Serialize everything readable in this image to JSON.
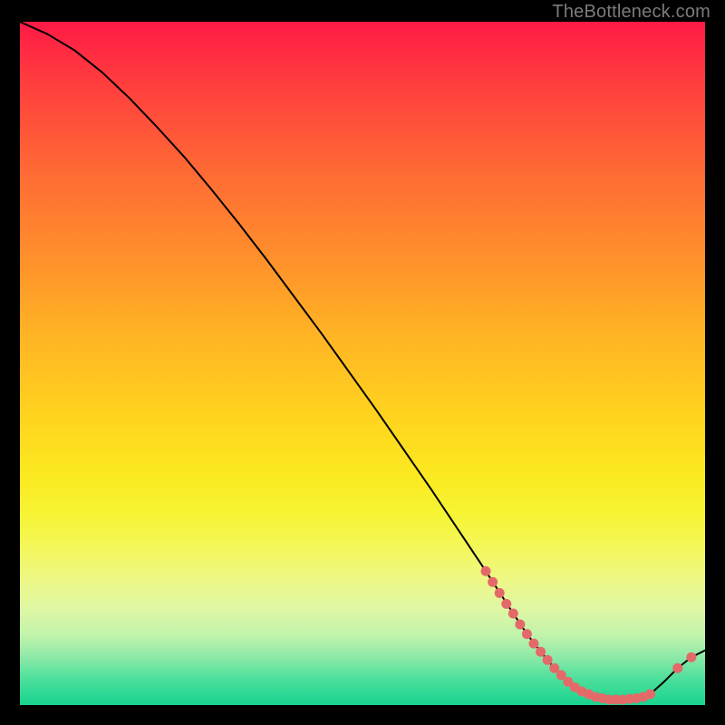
{
  "watermark": "TheBottleneck.com",
  "colors": {
    "curve_stroke": "#000000",
    "marker_fill": "#e46a6a",
    "marker_stroke": "#e46a6a",
    "frame_bg": "#000000"
  },
  "chart_data": {
    "type": "line",
    "title": "",
    "xlabel": "",
    "ylabel": "",
    "xlim": [
      0,
      100
    ],
    "ylim": [
      0,
      100
    ],
    "grid": false,
    "legend": false,
    "x": [
      0,
      4,
      8,
      12,
      16,
      20,
      24,
      28,
      32,
      36,
      40,
      44,
      48,
      52,
      56,
      60,
      64,
      68,
      72,
      74,
      76,
      78,
      80,
      82,
      84,
      86,
      88,
      90,
      92,
      94,
      96,
      98,
      100
    ],
    "values": [
      100,
      98.2,
      95.8,
      92.6,
      88.8,
      84.6,
      80.2,
      75.4,
      70.4,
      65.2,
      59.8,
      54.4,
      48.8,
      43.2,
      37.4,
      31.6,
      25.6,
      19.6,
      13.4,
      10.4,
      7.8,
      5.4,
      3.4,
      2.0,
      1.2,
      0.8,
      0.8,
      1.0,
      1.6,
      3.4,
      5.4,
      7.0,
      8.0
    ],
    "markers": {
      "comment": "dense marker cluster on descending limb (x≈68–76) and flat trough (x≈78–92), plus two on rising tail (x≈96–98)",
      "x": [
        68,
        69,
        70,
        71,
        72,
        73,
        74,
        75,
        76,
        77,
        78,
        79,
        80,
        81,
        82,
        83,
        84,
        85,
        86,
        87,
        88,
        89,
        90,
        91,
        92,
        96,
        98
      ],
      "y": [
        19.6,
        18.0,
        16.4,
        14.8,
        13.4,
        11.8,
        10.4,
        9.0,
        7.8,
        6.6,
        5.4,
        4.4,
        3.4,
        2.6,
        2.0,
        1.6,
        1.2,
        1.0,
        0.8,
        0.8,
        0.8,
        0.9,
        1.0,
        1.2,
        1.6,
        5.4,
        7.0
      ]
    }
  }
}
